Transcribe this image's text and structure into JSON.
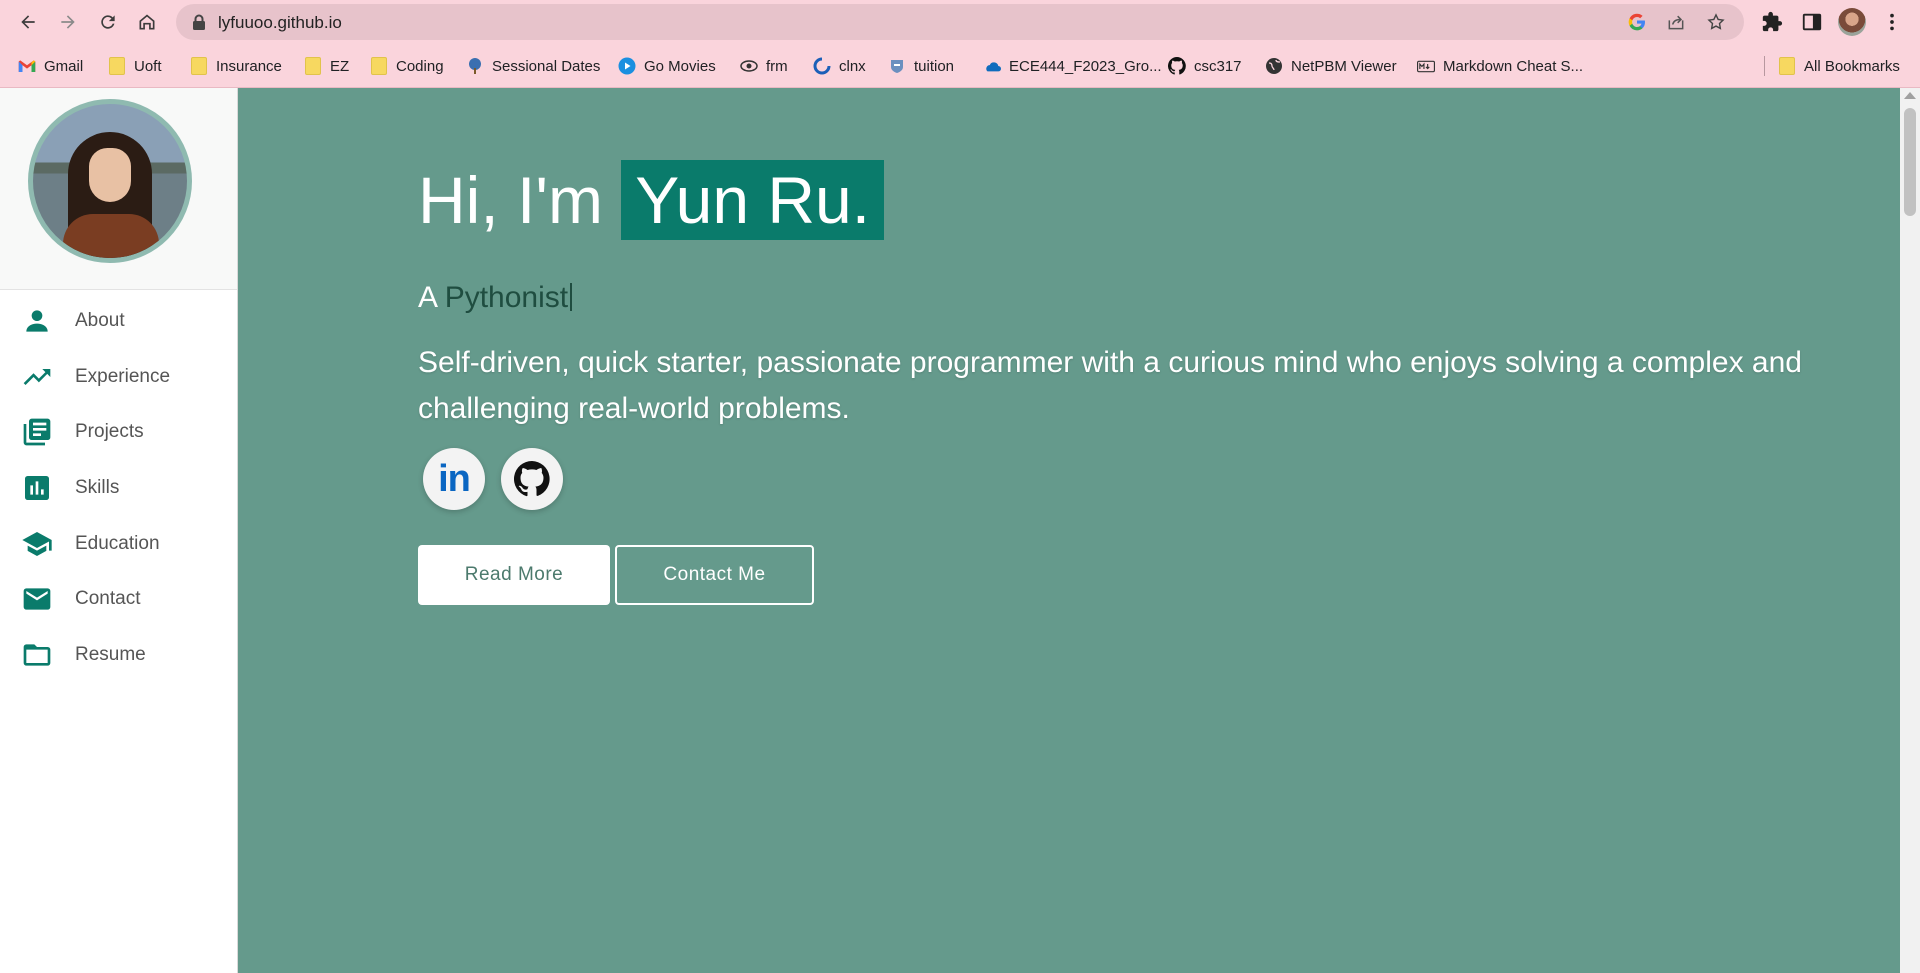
{
  "browser": {
    "url": "lyfuuoo.github.io"
  },
  "bookmarks": [
    {
      "label": "Gmail",
      "icon": "gmail-icon"
    },
    {
      "label": "Uoft",
      "icon": "folder-icon"
    },
    {
      "label": "Insurance",
      "icon": "folder-icon"
    },
    {
      "label": "EZ",
      "icon": "folder-icon"
    },
    {
      "label": "Coding",
      "icon": "folder-icon"
    },
    {
      "label": "Sessional Dates",
      "icon": "tree-icon"
    },
    {
      "label": "Go Movies",
      "icon": "play-icon"
    },
    {
      "label": "frm",
      "icon": "eye-icon"
    },
    {
      "label": "clnx",
      "icon": "refresh-circle-icon"
    },
    {
      "label": "tuition",
      "icon": "crest-icon"
    },
    {
      "label": "ECE444_F2023_Gro...",
      "icon": "onedrive-icon"
    },
    {
      "label": "csc317",
      "icon": "github-icon"
    },
    {
      "label": "NetPBM Viewer",
      "icon": "globe-icon"
    },
    {
      "label": "Markdown Cheat S...",
      "icon": "markdown-icon"
    }
  ],
  "all_bookmarks": "All Bookmarks",
  "sidebar": {
    "items": [
      {
        "label": "About",
        "icon": "person-icon"
      },
      {
        "label": "Experience",
        "icon": "trending-up-icon"
      },
      {
        "label": "Projects",
        "icon": "library-books-icon"
      },
      {
        "label": "Skills",
        "icon": "bar-chart-icon"
      },
      {
        "label": "Education",
        "icon": "graduation-cap-icon"
      },
      {
        "label": "Contact",
        "icon": "mail-icon"
      },
      {
        "label": "Resume",
        "icon": "folder-open-icon"
      }
    ]
  },
  "hero": {
    "greeting": "Hi, I'm ",
    "name": "Yun Ru.",
    "subtitle_prefix": "A ",
    "subtitle_role": "Pythonist",
    "description": "Self-driven, quick starter, passionate programmer with a curious mind who enjoys solving a complex and challenging real-world problems.",
    "linkedin_label": "in",
    "read_more": "Read More",
    "contact_me": "Contact Me"
  },
  "colors": {
    "accent": "#0a7b6b",
    "main_bg": "#659a8c",
    "chrome_bg": "#fad4dc"
  }
}
